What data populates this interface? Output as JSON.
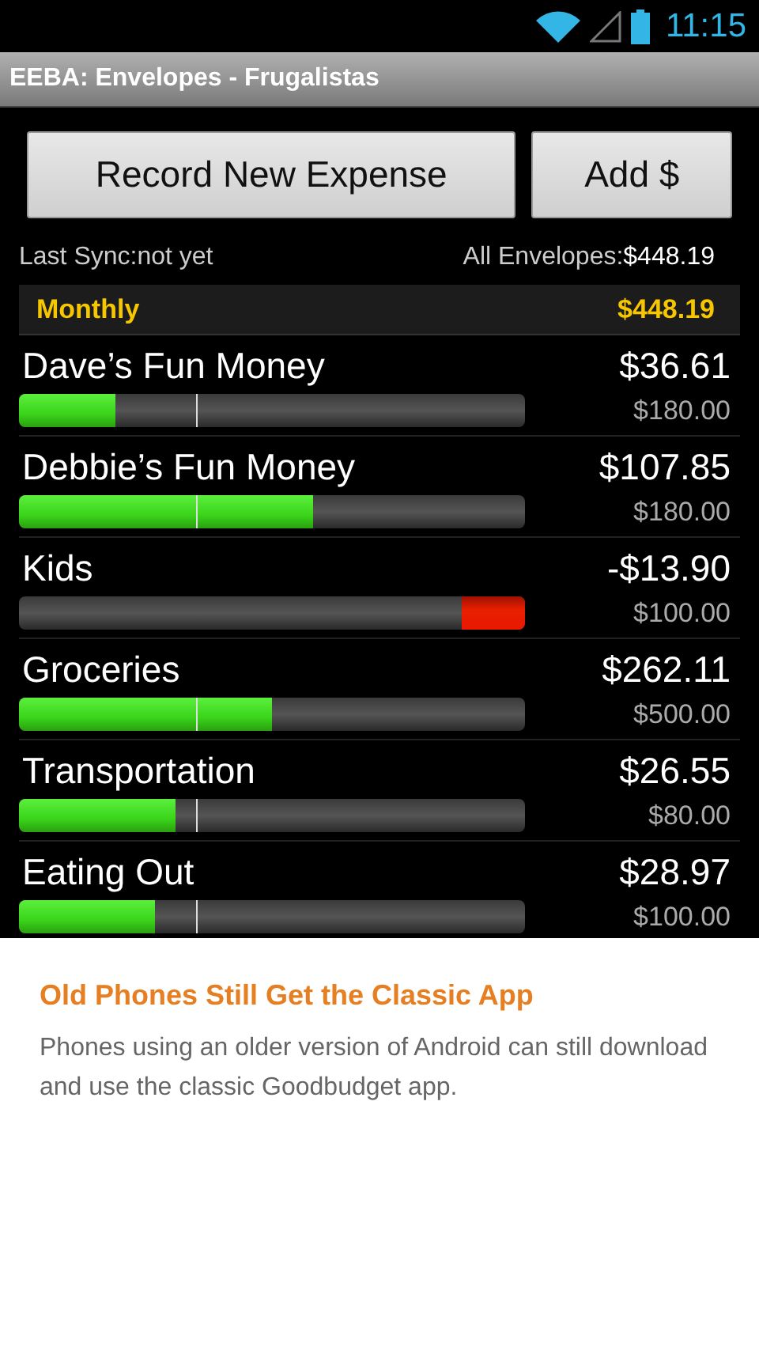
{
  "status_bar": {
    "time": "11:15"
  },
  "window": {
    "title": "EEBA: Envelopes - Frugalistas"
  },
  "buttons": [
    {
      "label": "Record New Expense"
    },
    {
      "label": "Add $"
    }
  ],
  "summary": {
    "last_sync": "Last Sync:not yet",
    "all_label": "All Envelopes:",
    "all_amount": "$448.19"
  },
  "group": {
    "name": "Monthly",
    "total": "$448.19"
  },
  "envelopes": [
    {
      "name": "Dave’s Fun Money",
      "balance": "$36.61",
      "budget": "$180.00",
      "level": 0.19,
      "overspent": false
    },
    {
      "name": "Debbie’s Fun Money",
      "balance": "$107.85",
      "budget": "$180.00",
      "level": 0.58,
      "overspent": false
    },
    {
      "name": "Kids",
      "balance": "-$13.90",
      "budget": "$100.00",
      "level": 0.125,
      "overspent": true
    },
    {
      "name": "Groceries",
      "balance": "$262.11",
      "budget": "$500.00",
      "level": 0.5,
      "overspent": false
    },
    {
      "name": "Transportation",
      "balance": "$26.55",
      "budget": "$80.00",
      "level": 0.31,
      "overspent": false
    },
    {
      "name": "Eating Out",
      "balance": "$28.97",
      "budget": "$100.00",
      "level": 0.27,
      "overspent": false
    }
  ],
  "caption": {
    "heading": "Old Phones Still Get the Classic App",
    "body": "Phones using an older version of Android can still download and use the classic Goodbudget app."
  }
}
